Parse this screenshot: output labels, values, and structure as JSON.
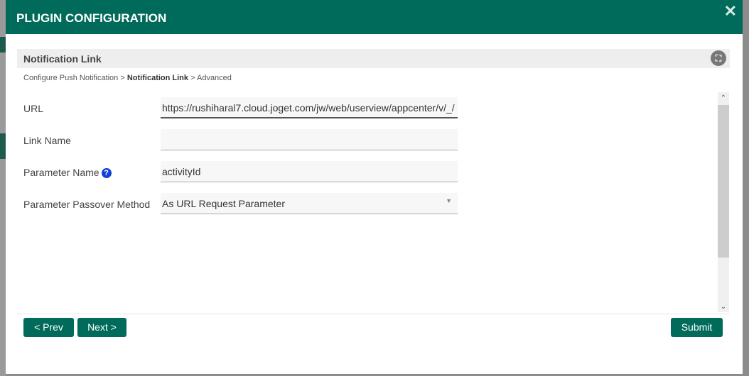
{
  "dialog": {
    "title": "PLUGIN CONFIGURATION"
  },
  "section": {
    "title": "Notification Link"
  },
  "breadcrumb": {
    "step1": "Configure Push Notification",
    "sep1": ">",
    "step2": "Notification Link",
    "sep2": ">",
    "step3": "Advanced"
  },
  "form": {
    "url": {
      "label": "URL",
      "value": "https://rushiharal7.cloud.joget.com/jw/web/userview/appcenter/v/_/"
    },
    "link_name": {
      "label": "Link Name",
      "value": ""
    },
    "param_name": {
      "label": "Parameter Name",
      "value": "activityId"
    },
    "passover": {
      "label": "Parameter Passover Method",
      "value": "As URL Request Parameter"
    }
  },
  "buttons": {
    "prev": "< Prev",
    "next": "Next >",
    "submit": "Submit"
  },
  "colors": {
    "brand": "#006b5a"
  }
}
